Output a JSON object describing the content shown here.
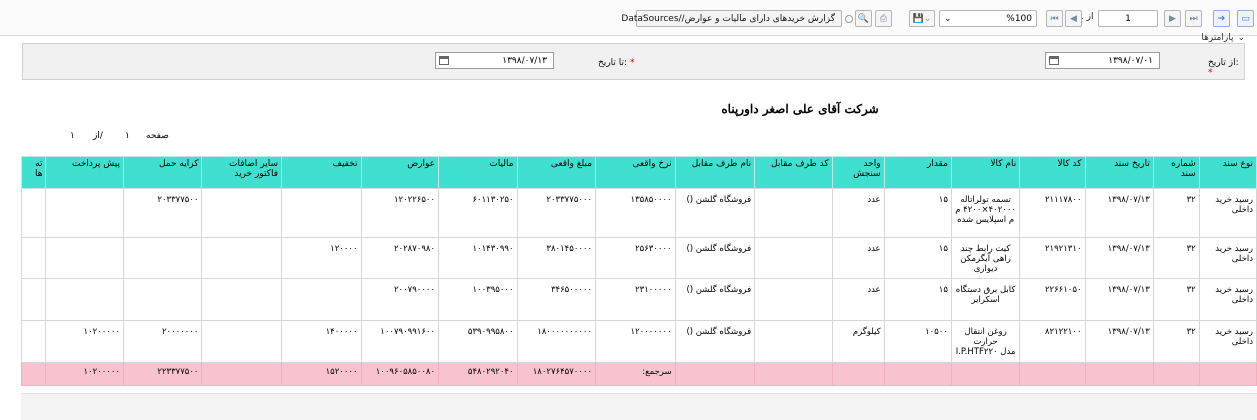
{
  "toolbar": {
    "page_current": "1",
    "page_of": "از 1",
    "zoom": "%100",
    "path": "DataSources//گزارش خریدهای دارای مالیات و عوارض"
  },
  "params": {
    "toggle_label": "پارامترها",
    "from_label": "از تاریخ:",
    "from_required": "*",
    "from_value": "۱۳۹۸/۰۷/۰۱",
    "to_label": "تا تاریخ:",
    "to_required": "*",
    "to_value": "۱۳۹۸/۰۷/۱۳"
  },
  "report": {
    "company": "شرکت آقای علی اصغر داورپناه",
    "page_word": "صفحه",
    "page_num": "۱",
    "page_sep": "از/",
    "page_total": "۱"
  },
  "table": {
    "columns": [
      "ته ها",
      "پیش پرداخت",
      "کرایه حمل",
      "سایر اضافات فاکتور خرید",
      "تخفیف",
      "عوارض",
      "مالیات",
      "مبلغ واقعی",
      "نرخ واقعی",
      "نام طرف مقابل",
      "کد طرف مقابل",
      "واحد سنجش",
      "مقدار",
      "نام کالا",
      "کد کالا",
      "تاریخ سند",
      "شماره سند",
      "نوع سند"
    ],
    "rows": [
      [
        "",
        "",
        "۲۰۳۳۷۷۵۰۰",
        "",
        "",
        "۱۲۰۲۲۶۵۰۰",
        "۶۰۱۱۳۰۲۵۰",
        "۲۰۳۳۷۷۵۰۰۰",
        "۱۳۵۸۵۰۰۰۰",
        "() فروشگاه گلشن",
        "",
        "عدد",
        "۱۵",
        "تسمه تولراتاله ۴۰۲۰۰۰×۴۲۰۰ م م اسپلایس شده",
        "۲۱۱۱۷۸۰۰",
        "۱۳۹۸/۰۷/۱۳",
        "۳۲",
        "رسید خرید داخلی"
      ],
      [
        "",
        "",
        "",
        "",
        "۱۲۰۰۰۰",
        "۲۰۲۸۷۰۹۸۰",
        "۱۰۱۴۳۰۹۹۰",
        "۳۸۰۱۴۵۰۰۰۰",
        "۲۵۶۳۰۰۰۰",
        "() فروشگاه گلشن",
        "",
        "عدد",
        "۱۵",
        "کیت رابط چند راهی آبگرمکن دیواری",
        "۲۱۹۲۱۳۱۰",
        "۱۳۹۸/۰۷/۱۳",
        "۳۲",
        "رسید خرید داخلی"
      ],
      [
        "",
        "",
        "",
        "",
        "",
        "۲۰۰۷۹۰۰۰۰",
        "۱۰۰۳۹۵۰۰۰",
        "۳۴۶۵۰۰۰۰۰",
        "۲۳۱۰۰۰۰۰",
        "() فروشگاه گلشن",
        "",
        "عدد",
        "۱۵",
        "کابل برق دستگاه اسکرایر",
        "۲۲۶۶۱۰۵۰",
        "۱۳۹۸/۰۷/۱۳",
        "۳۲",
        "رسید خرید داخلی"
      ],
      [
        "",
        "۱۰۲۰۰۰۰۰",
        "۲۰۰۰۰۰۰۰",
        "",
        "۱۴۰۰۰۰۰",
        "۱۰۰۷۹۰۹۹۱۶۰۰",
        "۵۳۹۰۹۹۵۸۰۰",
        "۱۸۰۰۰۰۰۰۰۰۰۰",
        "۱۲۰۰۰۰۰۰۰",
        "() فروشگاه گلشن",
        "",
        "کیلوگرم",
        "۱۰۵۰۰",
        "روغن انتقال حرارت I.P.HTF۲۲۰ مدل",
        "۸۲۱۲۲۱۰۰",
        "۱۳۹۸/۰۷/۱۳",
        "۳۲",
        "رسید خرید داخلی"
      ]
    ],
    "total_label": ":سرجمع",
    "totals": {
      "prepay": "۱۰۲۰۰۰۰۰",
      "freight": "۲۲۳۳۷۷۵۰۰",
      "discount": "۱۵۲۰۰۰۰",
      "duty": "۱۰۰۹۶۰۵۸۵۰۰۸۰",
      "tax": "۵۴۸۰۲۹۲۰۴۰",
      "amount": "۱۸۰۲۷۶۴۵۷۰۰۰۰"
    }
  },
  "colors": {
    "header_bg": "#3fe0d0",
    "total_bg": "#f8c3cf"
  }
}
